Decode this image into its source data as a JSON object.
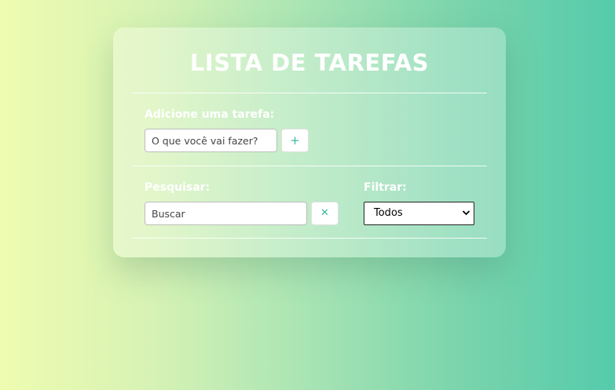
{
  "app": {
    "title": "LISTA DE TAREFAS"
  },
  "add_task": {
    "label": "Adicione uma tarefa:",
    "placeholder": "O que você vai fazer?",
    "add_button_icon": "plus-icon",
    "add_button_label": "+"
  },
  "search": {
    "label": "Pesquisar:",
    "placeholder": "Buscar",
    "clear_button_icon": "close-icon",
    "clear_button_label": "✕"
  },
  "filter": {
    "label": "Filtrar:",
    "selected": "Todos"
  },
  "colors": {
    "accent": "#3cb8a0",
    "background_start": "#eefcb0",
    "background_end": "#55cbab"
  }
}
